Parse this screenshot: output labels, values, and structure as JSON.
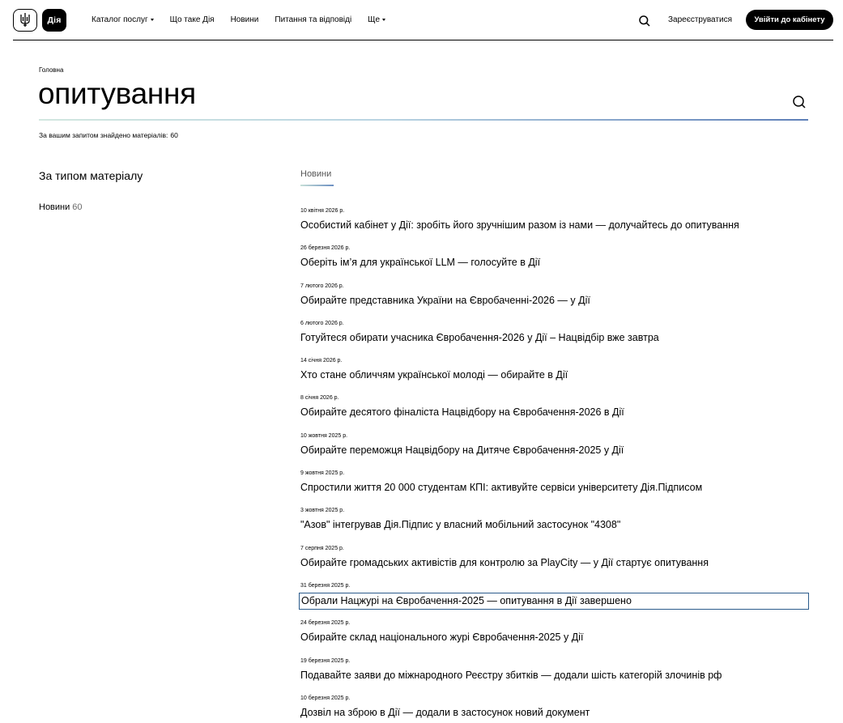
{
  "header": {
    "nav": [
      {
        "label": "Каталог послуг",
        "dropdown": true
      },
      {
        "label": "Що таке Дія",
        "dropdown": false
      },
      {
        "label": "Новини",
        "dropdown": false
      },
      {
        "label": "Питання та відповіді",
        "dropdown": false
      },
      {
        "label": "Ще",
        "dropdown": true
      }
    ],
    "logo_text": "Дія",
    "register_label": "Зареєструватися",
    "login_label": "Увійти до кабінету"
  },
  "breadcrumb": "Головна",
  "search": {
    "query": "опитування",
    "found_label": "За вашим запитом знайдено матеріалів:",
    "found_count": "60"
  },
  "filters": {
    "title": "За типом матеріалу",
    "items": [
      {
        "label": "Новини",
        "count": "60"
      }
    ]
  },
  "tabs": [
    {
      "label": "Новини",
      "active": true
    }
  ],
  "news": [
    {
      "date": "10 квітня 2026 р.",
      "title": "Особистий кабінет у Дії: зробіть його зручнішим разом із нами — долучайтесь до опитування"
    },
    {
      "date": "26 березня 2026 р.",
      "title": "Оберіть ім’я для української LLM — голосуйте в Дії"
    },
    {
      "date": "7 лютого 2026 р.",
      "title": "Обирайте представника України на Євробаченні-2026 — у Дії"
    },
    {
      "date": "6 лютого 2026 р.",
      "title": "Готуйтеся обирати учасника Євробачення-2026 у Дії – Нацвідбір вже завтра"
    },
    {
      "date": "14 січня 2026 р.",
      "title": "Хто стане обличчям української молоді — обирайте в Дії"
    },
    {
      "date": "8 січня 2026 р.",
      "title": "Обирайте десятого фіналіста Нацвідбору на Євробачення-2026 в Дії"
    },
    {
      "date": "10 жовтня 2025 р.",
      "title": "Обирайте переможця Нацвідбору на Дитяче Євробачення-2025 у Дії"
    },
    {
      "date": "9 жовтня 2025 р.",
      "title": "Спростили життя 20 000 студентам КПІ: активуйте сервіси університету Дія.Підписом"
    },
    {
      "date": "3 жовтня 2025 р.",
      "title": "\"Азов\" інтегрував Дія.Підпис у власний мобільний застосунок \"4308\""
    },
    {
      "date": "7 серпня 2025 р.",
      "title": "Обирайте громадських активістів для контролю за PlayCity — у Дії стартує опитування"
    },
    {
      "date": "31 березня 2025 р.",
      "title": "Обрали Нацжурі на Євробачення-2025 — опитування в Дії завершено",
      "focused": true
    },
    {
      "date": "24 березня 2025 р.",
      "title": "Обирайте склад національного журі Євробачення-2025 у Дії"
    },
    {
      "date": "19 березня 2025 р.",
      "title": "Подавайте заяви до міжнародного Реєстру збитків — додали шість категорій злочинів рф"
    },
    {
      "date": "10 березня 2025 р.",
      "title": "Дозвіл на зброю в Дії — додали в застосунок новий документ"
    }
  ]
}
